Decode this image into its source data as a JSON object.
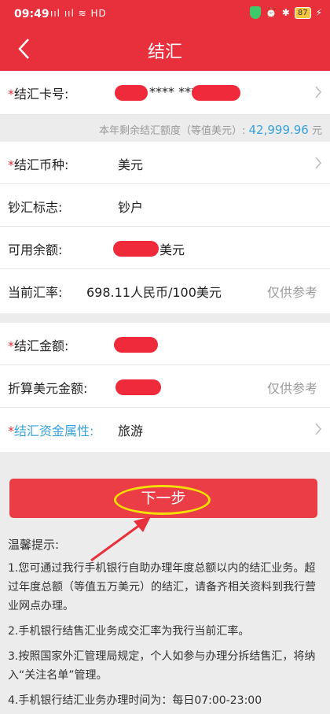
{
  "status_bar": {
    "time": "09:49",
    "left_icons": "ııl ııl ≋ HD",
    "battery": "87"
  },
  "header": {
    "title": "结汇"
  },
  "card_row": {
    "label": "结汇卡号:",
    "value_masked": "**** ****"
  },
  "quota": {
    "label": "本年剩余结汇额度（等值美元）:",
    "amount": "42,999.96",
    "unit": "元"
  },
  "currency_section": {
    "currency": {
      "label": "结汇币种:",
      "value": "美元"
    },
    "cash_flag": {
      "label": "钞汇标志:",
      "value": "钞户"
    },
    "balance": {
      "label": "可用余额:",
      "unit": "美元"
    },
    "rate": {
      "label": "当前汇率:",
      "value": "698.11人民币/100美元",
      "hint": "仅供参考"
    }
  },
  "amount_section": {
    "amount": {
      "label": "结汇金额:"
    },
    "usd_amount": {
      "label": "折算美元金额:",
      "hint": "仅供参考"
    },
    "purpose": {
      "label": "结汇资金属性:",
      "value": "旅游"
    }
  },
  "next_button": {
    "label": "下一步"
  },
  "tips": {
    "title": "温馨提示:",
    "items": [
      "1.您可通过我行手机银行自助办理年度总额以内的结汇业务。超过年度总额（等值五万美元）的结汇，请备齐相关资料到我行营业网点办理。",
      "2.手机银行结售汇业务成交汇率为我行当前汇率。",
      "3.按照国家外汇管理局规定，个人如参与办理分拆结售汇，将纳入“关注名单”管理。",
      "4.手机银行结汇业务办理时间为：每日07:00-23:00"
    ]
  },
  "colors": {
    "brand": "#e8303c",
    "accent_blue": "#37a2dc",
    "annotation": "#f4e000"
  }
}
